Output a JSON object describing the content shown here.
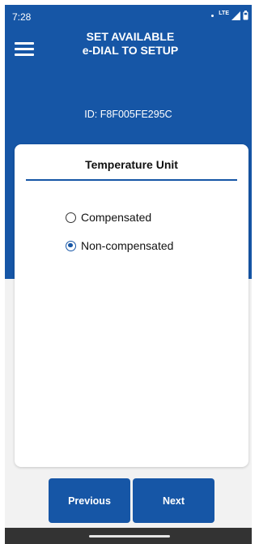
{
  "status_bar": {
    "time": "7:28",
    "network": "LTE",
    "icons": [
      "notification-dot",
      "signal-icon",
      "battery-icon"
    ]
  },
  "header": {
    "menu_icon": "hamburger-menu-icon",
    "title_line1": "SET AVAILABLE",
    "title_line2": "e-DIAL TO SETUP",
    "device_id": "ID: F8F005FE295C"
  },
  "card": {
    "title": "Temperature Unit",
    "options": [
      {
        "label": "Compensated",
        "selected": false
      },
      {
        "label": "Non-compensated",
        "selected": true
      }
    ]
  },
  "footer": {
    "previous_label": "Previous",
    "next_label": "Next"
  },
  "colors": {
    "primary": "#1656a6",
    "background": "#f2f2f2",
    "card": "#ffffff",
    "nav_bar": "#333333"
  }
}
